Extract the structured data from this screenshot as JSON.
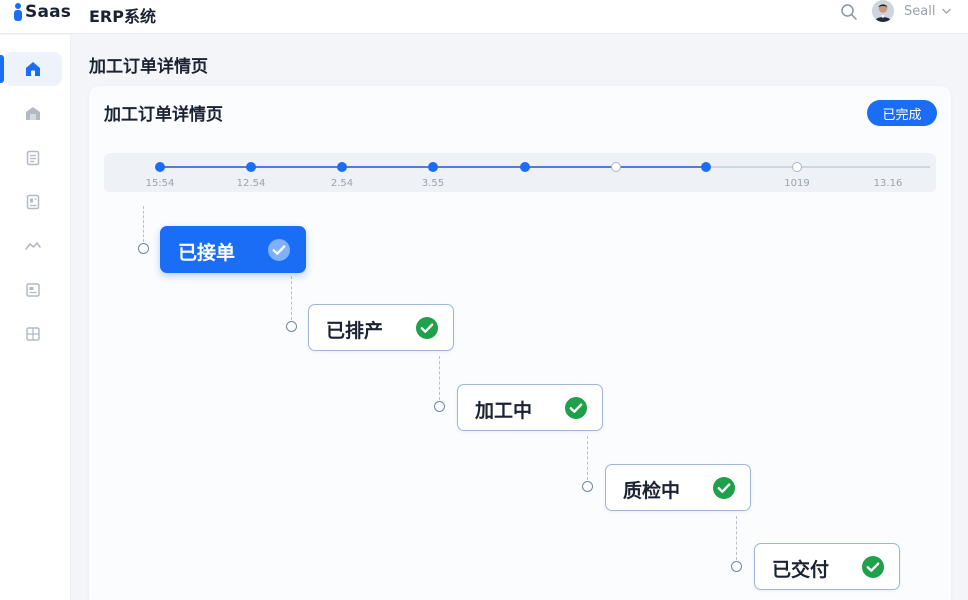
{
  "header": {
    "brand": "Saas",
    "app_title": "ERP系统",
    "user_name": "Seall"
  },
  "sidebar": {
    "items": [
      {
        "icon": "home-icon",
        "active": true
      },
      {
        "icon": "warehouse-icon",
        "active": false
      },
      {
        "icon": "document-icon",
        "active": false
      },
      {
        "icon": "book-icon",
        "active": false
      },
      {
        "icon": "chart-icon",
        "active": false
      },
      {
        "icon": "report-icon",
        "active": false
      },
      {
        "icon": "grid-icon",
        "active": false
      }
    ]
  },
  "page": {
    "title": "加工订单详情页"
  },
  "card": {
    "title": "加工订单详情页",
    "status": "已完成"
  },
  "timeline": {
    "labels": [
      "15:54",
      "12.54",
      "2.54",
      "3.55",
      "",
      "",
      "",
      "1019",
      "13.16"
    ]
  },
  "steps": [
    {
      "label": "已接单",
      "done": true,
      "active": true
    },
    {
      "label": "已排产",
      "done": true,
      "active": false
    },
    {
      "label": "加工中",
      "done": true,
      "active": false
    },
    {
      "label": "质检中",
      "done": true,
      "active": false
    },
    {
      "label": "已交付",
      "done": true,
      "active": false
    }
  ],
  "colors": {
    "accent": "#1a6ef5",
    "success": "#1fa04a",
    "background": "#f3f5f9"
  }
}
